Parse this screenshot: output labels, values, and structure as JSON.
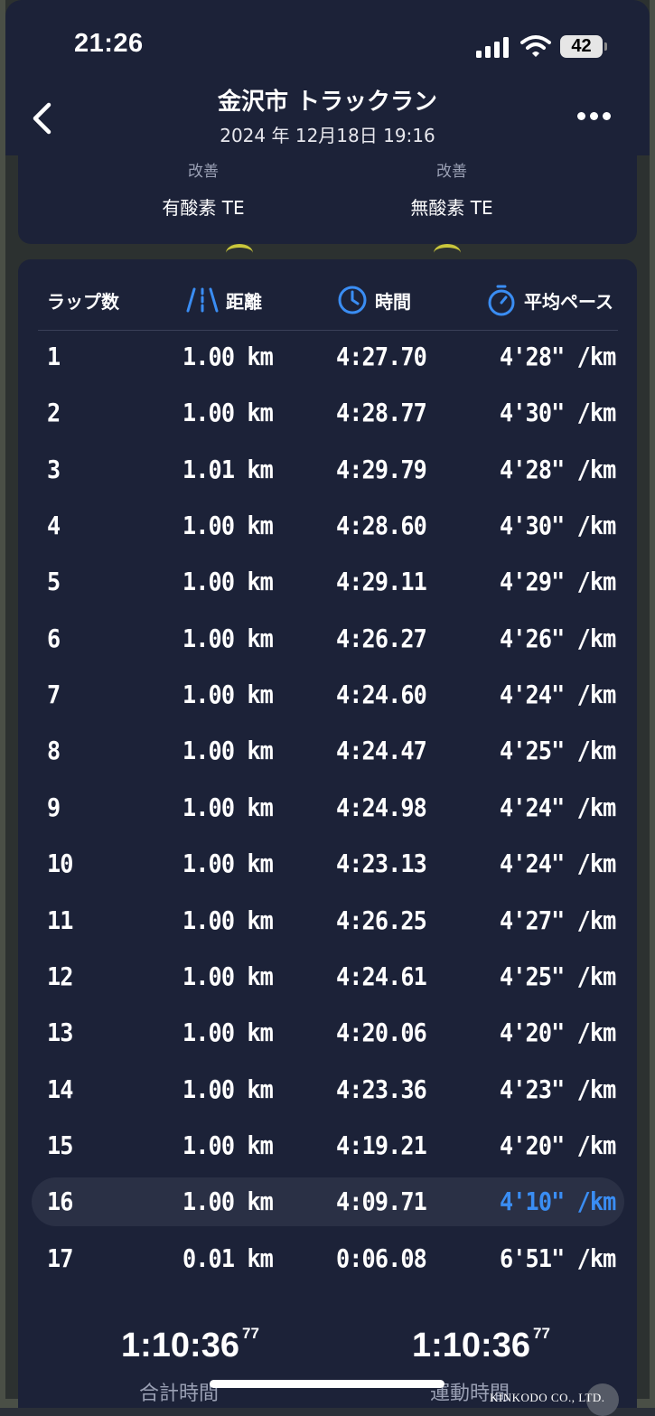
{
  "status_bar": {
    "time": "21:26",
    "battery": "42"
  },
  "header": {
    "title": "金沢市 トラックラン",
    "subtitle": "2024 年 12月18日 19:16"
  },
  "training_effect": [
    {
      "status": "改善",
      "label": "有酸素 TE"
    },
    {
      "status": "改善",
      "label": "無酸素 TE"
    }
  ],
  "laps_table": {
    "headers": {
      "lap": "ラップ数",
      "distance": "距離",
      "time": "時間",
      "pace": "平均ペース"
    },
    "rows": [
      {
        "lap": "1",
        "distance": "1.00 km",
        "time": "4:27.70",
        "pace": "4'28\" /km"
      },
      {
        "lap": "2",
        "distance": "1.00 km",
        "time": "4:28.77",
        "pace": "4'30\" /km"
      },
      {
        "lap": "3",
        "distance": "1.01 km",
        "time": "4:29.79",
        "pace": "4'28\" /km"
      },
      {
        "lap": "4",
        "distance": "1.00 km",
        "time": "4:28.60",
        "pace": "4'30\" /km"
      },
      {
        "lap": "5",
        "distance": "1.00 km",
        "time": "4:29.11",
        "pace": "4'29\" /km"
      },
      {
        "lap": "6",
        "distance": "1.00 km",
        "time": "4:26.27",
        "pace": "4'26\" /km"
      },
      {
        "lap": "7",
        "distance": "1.00 km",
        "time": "4:24.60",
        "pace": "4'24\" /km"
      },
      {
        "lap": "8",
        "distance": "1.00 km",
        "time": "4:24.47",
        "pace": "4'25\" /km"
      },
      {
        "lap": "9",
        "distance": "1.00 km",
        "time": "4:24.98",
        "pace": "4'24\" /km"
      },
      {
        "lap": "10",
        "distance": "1.00 km",
        "time": "4:23.13",
        "pace": "4'24\" /km"
      },
      {
        "lap": "11",
        "distance": "1.00 km",
        "time": "4:26.25",
        "pace": "4'27\" /km"
      },
      {
        "lap": "12",
        "distance": "1.00 km",
        "time": "4:24.61",
        "pace": "4'25\" /km"
      },
      {
        "lap": "13",
        "distance": "1.00 km",
        "time": "4:20.06",
        "pace": "4'20\" /km"
      },
      {
        "lap": "14",
        "distance": "1.00 km",
        "time": "4:23.36",
        "pace": "4'23\" /km"
      },
      {
        "lap": "15",
        "distance": "1.00 km",
        "time": "4:19.21",
        "pace": "4'20\" /km"
      },
      {
        "lap": "16",
        "distance": "1.00 km",
        "time": "4:09.71",
        "pace": "4'10\" /km",
        "best": true
      },
      {
        "lap": "17",
        "distance": "0.01 km",
        "time": "0:06.08",
        "pace": "6'51\" /km"
      }
    ]
  },
  "totals": [
    {
      "value": "1:10:36",
      "fraction": "77",
      "label": "合計時間"
    },
    {
      "value": "1:10:36",
      "fraction": "77",
      "label": "運動時間"
    }
  ],
  "watermark": "KINKODO CO., LTD.",
  "colors": {
    "accent": "#3a8df3",
    "card": "#1c2238",
    "highlight_row": "#2a3045",
    "muted_text": "#9aa0b4"
  },
  "icons": {
    "distance": "road-icon",
    "time": "clock-icon",
    "pace": "stopwatch-icon",
    "back": "chevron-left-icon",
    "more": "more-horizontal-icon"
  }
}
